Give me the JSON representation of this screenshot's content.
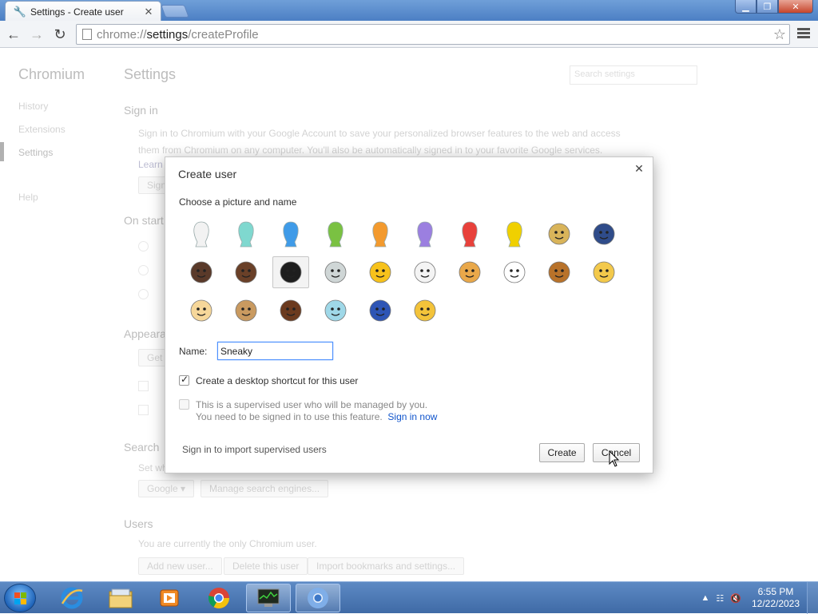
{
  "browser": {
    "tab_title": "Settings - Create user",
    "url_scheme": "chrome://",
    "url_host": "settings",
    "url_path": "/createProfile"
  },
  "settings_page": {
    "brand": "Chromium",
    "nav": [
      "History",
      "Extensions",
      "Settings",
      "Help"
    ],
    "heading": "Settings",
    "search_placeholder": "Search settings",
    "sign_in": {
      "title": "Sign in",
      "text1": "Sign in to Chromium with your Google Account to save your personalized browser features to the web and access",
      "text2": "them from Chromium on any computer. You'll also be automatically signed in to your favorite Google services.",
      "learn": "Learn",
      "button": "Sign"
    },
    "on_startup": {
      "title": "On start"
    },
    "appearance": {
      "title": "Appeara",
      "button": "Get t"
    },
    "search": {
      "title": "Search",
      "text": "Set wh",
      "engine": "Google",
      "manage": "Manage search engines..."
    },
    "users": {
      "title": "Users",
      "text": "You are currently the only Chromium user.",
      "add": "Add new user...",
      "delete": "Delete this user",
      "import": "Import bookmarks and settings..."
    }
  },
  "dialog": {
    "title": "Create user",
    "prompt": "Choose a picture and name",
    "name_label": "Name:",
    "name_value": "Sneaky",
    "shortcut_label": "Create a desktop shortcut for this user",
    "shortcut_checked": true,
    "supervised_label": "This is a supervised user who will be managed by you.",
    "supervised_note": "You need to be signed in to use this feature.",
    "sign_in_link": "Sign in now",
    "supervised_checked": false,
    "import_link": "Sign in to import supervised users",
    "create_button": "Create",
    "cancel_button": "Cancel",
    "avatars": [
      {
        "name": "avatar-white-silhouette",
        "color": "#f2f2f2"
      },
      {
        "name": "avatar-teal-silhouette",
        "color": "#7fd8cf"
      },
      {
        "name": "avatar-blue-silhouette",
        "color": "#3f9be8"
      },
      {
        "name": "avatar-green-silhouette",
        "color": "#7ac142"
      },
      {
        "name": "avatar-orange-silhouette",
        "color": "#f39a2e"
      },
      {
        "name": "avatar-purple-silhouette",
        "color": "#9b7fe0"
      },
      {
        "name": "avatar-red-silhouette",
        "color": "#e8413b"
      },
      {
        "name": "avatar-yellow-silhouette",
        "color": "#f0d000"
      },
      {
        "name": "avatar-businesswoman",
        "color": "#d9b45a"
      },
      {
        "name": "avatar-superhero",
        "color": "#2f4c8a"
      },
      {
        "name": "avatar-woman-sunglasses",
        "color": "#5a3a2a"
      },
      {
        "name": "avatar-businessman",
        "color": "#6a4028"
      },
      {
        "name": "avatar-ninja",
        "color": "#1e1e1e"
      },
      {
        "name": "avatar-alien",
        "color": "#cfd6d6"
      },
      {
        "name": "avatar-smiley",
        "color": "#f7c21b"
      },
      {
        "name": "avatar-flower",
        "color": "#f4f4f4"
      },
      {
        "name": "avatar-pizza",
        "color": "#e9a84a"
      },
      {
        "name": "avatar-soccer-ball",
        "color": "#ffffff"
      },
      {
        "name": "avatar-burger",
        "color": "#b8722a"
      },
      {
        "name": "avatar-cat",
        "color": "#f3c94b"
      },
      {
        "name": "avatar-cupcake",
        "color": "#f6d79a"
      },
      {
        "name": "avatar-dog",
        "color": "#c99a60"
      },
      {
        "name": "avatar-horse",
        "color": "#6b3a1e"
      },
      {
        "name": "avatar-cocktail",
        "color": "#9fd8e8"
      },
      {
        "name": "avatar-music-note",
        "color": "#2e55b5"
      },
      {
        "name": "avatar-sun-cloud",
        "color": "#f3c33a"
      }
    ],
    "selected_avatar": "avatar-ninja"
  },
  "taskbar": {
    "time": "6:55 PM",
    "date": "12/22/2023",
    "items": [
      "internet-explorer",
      "file-explorer",
      "media-player",
      "chromium-browser",
      "task-manager",
      "chromium"
    ]
  }
}
